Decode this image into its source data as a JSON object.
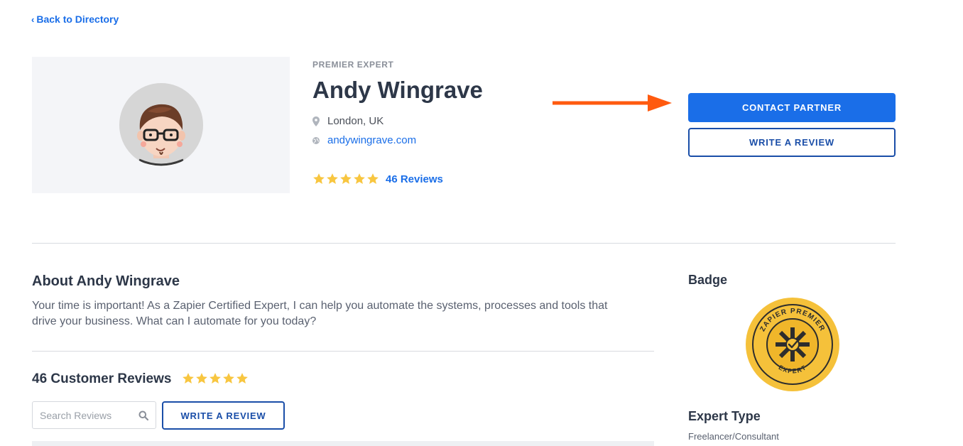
{
  "nav": {
    "back_label": "Back to Directory"
  },
  "profile": {
    "eyebrow": "PREMIER EXPERT",
    "name": "Andy Wingrave",
    "location": "London, UK",
    "website": "andywingrave.com",
    "rating": 5,
    "reviews_label": "46 Reviews"
  },
  "actions": {
    "contact_label": "CONTACT PARTNER",
    "write_review_label": "WRITE A REVIEW"
  },
  "about": {
    "title": "About Andy Wingrave",
    "text": "Your time is important! As a Zapier Certified Expert, I can help you automate the systems, processes and tools that drive your business. What can I automate for you today?"
  },
  "reviews": {
    "title": "46 Customer Reviews",
    "rating": 5,
    "search_placeholder": "Search Reviews",
    "write_review_label": "WRITE A REVIEW"
  },
  "sidebar": {
    "badge_title": "Badge",
    "badge_text_top": "ZAPIER PREMIER",
    "badge_text_bottom": "EXPERT",
    "expert_type_title": "Expert Type",
    "expert_type_value": "Freelancer/Consultant"
  },
  "colors": {
    "accent": "#1a6ee8",
    "arrow": "#ff5a0f",
    "star": "#f8c640",
    "badge": "#f5c13a"
  },
  "icons": {
    "back": "chevron-left-icon",
    "location": "map-pin-icon",
    "website": "globe-icon",
    "search": "search-icon",
    "star": "star-icon"
  }
}
